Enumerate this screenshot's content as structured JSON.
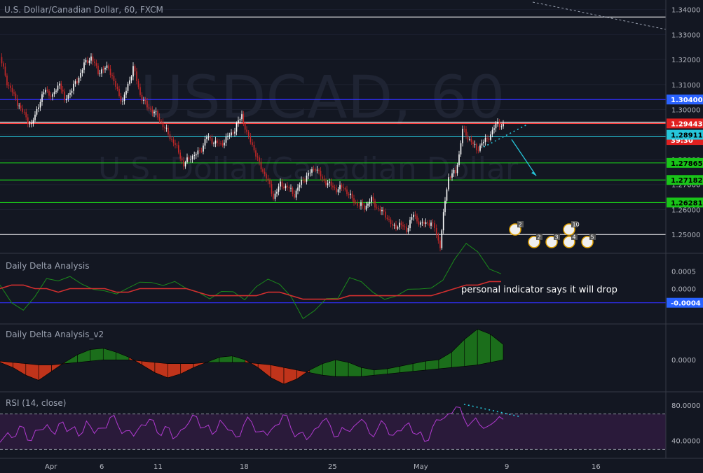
{
  "chart_data": [
    {
      "type": "candlestick",
      "title": "U.S. Dollar/Canadian Dollar, 60, FXCM",
      "watermark": {
        "symbol": "USDCAD, 60",
        "name": "U.S. Dollar/Canadian Dollar"
      },
      "x_ticks": [
        "Apr",
        "6",
        "11",
        "18",
        "25",
        "May",
        "9",
        "16"
      ],
      "y_ticks": [
        "1.34000",
        "1.33000",
        "1.32000",
        "1.31000",
        "1.30000",
        "1.29000",
        "1.28000",
        "1.27000",
        "1.26000",
        "1.25000"
      ],
      "ylim": [
        1.2425,
        1.3438
      ],
      "close_path": [
        [
          1.321,
          0
        ],
        [
          1.311,
          10
        ],
        [
          1.3055,
          20
        ],
        [
          1.299,
          32
        ],
        [
          1.2935,
          45
        ],
        [
          1.302,
          55
        ],
        [
          1.308,
          65
        ],
        [
          1.305,
          75
        ],
        [
          1.311,
          85
        ],
        [
          1.3035,
          92
        ],
        [
          1.307,
          100
        ],
        [
          1.3115,
          110
        ],
        [
          1.318,
          120
        ],
        [
          1.321,
          130
        ],
        [
          1.315,
          140
        ],
        [
          1.317,
          155
        ],
        [
          1.309,
          165
        ],
        [
          1.303,
          175
        ],
        [
          1.312,
          185
        ],
        [
          1.317,
          190
        ],
        [
          1.306,
          200
        ],
        [
          1.301,
          210
        ],
        [
          1.299,
          220
        ],
        [
          1.295,
          230
        ],
        [
          1.29,
          240
        ],
        [
          1.286,
          250
        ],
        [
          1.278,
          262
        ],
        [
          1.281,
          272
        ],
        [
          1.283,
          285
        ],
        [
          1.289,
          295
        ],
        [
          1.287,
          305
        ],
        [
          1.286,
          315
        ],
        [
          1.289,
          325
        ],
        [
          1.292,
          335
        ],
        [
          1.298,
          345
        ],
        [
          1.29,
          352
        ],
        [
          1.286,
          360
        ],
        [
          1.278,
          370
        ],
        [
          1.273,
          380
        ],
        [
          1.265,
          390
        ],
        [
          1.27,
          400
        ],
        [
          1.269,
          410
        ],
        [
          1.266,
          420
        ],
        [
          1.271,
          430
        ],
        [
          1.274,
          440
        ],
        [
          1.277,
          450
        ],
        [
          1.272,
          460
        ],
        [
          1.27,
          470
        ],
        [
          1.268,
          480
        ],
        [
          1.269,
          490
        ],
        [
          1.265,
          500
        ],
        [
          1.262,
          510
        ],
        [
          1.261,
          520
        ],
        [
          1.264,
          530
        ],
        [
          1.26,
          540
        ],
        [
          1.258,
          550
        ],
        [
          1.253,
          560
        ],
        [
          1.254,
          570
        ],
        [
          1.252,
          580
        ],
        [
          1.258,
          590
        ],
        [
          1.254,
          600
        ],
        [
          1.255,
          610
        ],
        [
          1.253,
          620
        ],
        [
          1.245,
          628
        ],
        [
          1.264,
          635
        ],
        [
          1.273,
          640
        ],
        [
          1.275,
          650
        ],
        [
          1.282,
          655
        ],
        [
          1.292,
          660
        ],
        [
          1.288,
          670
        ],
        [
          1.284,
          680
        ],
        [
          1.287,
          690
        ],
        [
          1.29,
          700
        ],
        [
          1.295,
          710
        ],
        [
          1.293,
          718
        ]
      ],
      "horizontal_levels": [
        {
          "value": 1.337,
          "color": "#ffffff",
          "label": ""
        },
        {
          "value": 1.304,
          "color": "#3030ff",
          "label": "1.30400"
        },
        {
          "value": 1.29493,
          "color": "#ffffff",
          "label": "1.29493"
        },
        {
          "value": 1.29443,
          "color": "#ff4040",
          "label": "1.29443"
        },
        {
          "value": 1.28911,
          "color": "#26c6da",
          "label": "1.28911"
        },
        {
          "value": 1.27865,
          "color": "#19c319",
          "label": "1.27865"
        },
        {
          "value": 1.27182,
          "color": "#19c319",
          "label": "1.27182"
        },
        {
          "value": 1.26281,
          "color": "#19c319",
          "label": "1.26281"
        },
        {
          "value": 1.25,
          "color": "#ffffff",
          "label": ""
        }
      ],
      "price_labels": [
        {
          "text": "1.30400",
          "value": 1.304,
          "bg": "#2962ff",
          "fg": "#ffffff"
        },
        {
          "text": "1.29493",
          "value": 1.29493,
          "bg": "#131722",
          "fg": "#ffffff"
        },
        {
          "text": "1.29443",
          "value": 1.29443,
          "bg": "#e02020",
          "fg": "#ffffff"
        },
        {
          "text": "39:30",
          "value": 1.28911,
          "bg": "#e02020",
          "fg": "#ffffff",
          "offset": -0.0013
        },
        {
          "text": "1.28911",
          "value": 1.28911,
          "bg": "#26c6da",
          "fg": "#000000",
          "offset": 0.0008
        },
        {
          "text": "1.27865",
          "value": 1.27865,
          "bg": "#19c319",
          "fg": "#000000"
        },
        {
          "text": "1.27182",
          "value": 1.27182,
          "bg": "#19c319",
          "fg": "#000000"
        },
        {
          "text": "1.26281",
          "value": 1.26281,
          "bg": "#19c319",
          "fg": "#000000"
        }
      ],
      "event_badges": [
        "2",
        "2",
        "3",
        "4",
        "5",
        "10"
      ],
      "colors": {
        "up": "#ffffff",
        "down": "#c62828",
        "accent": "#26c6da"
      }
    },
    {
      "type": "line",
      "title": "Daily Delta Analysis",
      "y_ticks": [
        "0.0005",
        "0.0000"
      ],
      "current_value_label": "-0.0004",
      "annotation": "personal indicator says it will drop",
      "series": [
        {
          "color": "#1b8a1b",
          "values": [
            0.0001,
            -0.0003,
            -0.0005,
            -0.0002,
            0.0002,
            0.0001,
            0.0003,
            0.0002,
            0.0001,
            0.0,
            -0.0002,
            -0.0001,
            0.0001,
            0.0002,
            0.0002,
            0.0003,
            0.0,
            -0.0002,
            -0.0004,
            -0.0001,
            0.0,
            -0.0002,
            0.0001,
            0.0002,
            0.0,
            -0.0003,
            -0.0008,
            -0.0005,
            -0.0002,
            -0.0003,
            0.0002,
            0.0001,
            -0.0001,
            -0.0002,
            -0.0001,
            0.0,
            -0.0001,
            -0.0001,
            0.0002,
            0.0009,
            0.0014,
            0.0011,
            0.0005,
            0.0003
          ]
        },
        {
          "color": "#d32f2f",
          "values": [
            0.0,
            0.0001,
            0.0001,
            0.0,
            0.0,
            -0.0001,
            0.0,
            0.0,
            0.0,
            0.0,
            -0.0001,
            -0.0001,
            0.0,
            0.0,
            0.0,
            0.0,
            0.0,
            -0.0001,
            -0.0002,
            -0.0002,
            -0.0002,
            -0.0002,
            -0.0002,
            -0.0001,
            -0.0001,
            -0.0002,
            -0.0003,
            -0.0003,
            -0.0003,
            -0.0003,
            -0.0002,
            -0.0002,
            -0.0002,
            -0.0002,
            -0.0002,
            -0.0002,
            -0.0002,
            -0.0002,
            -0.0001,
            0.0,
            0.0001,
            0.0001,
            0.0002,
            0.0002
          ]
        }
      ]
    },
    {
      "type": "area",
      "title": "Daily Delta Analysis_v2",
      "y_ticks": [
        "0.0000"
      ],
      "values": [
        -0.0002,
        -0.0006,
        -0.0012,
        -0.0016,
        -0.0009,
        -0.0002,
        0.0004,
        0.0008,
        0.0009,
        0.0006,
        0.0002,
        -0.0004,
        -0.001,
        -0.0014,
        -0.0011,
        -0.0006,
        -0.0002,
        0.0002,
        0.0003,
        0.0,
        -0.0006,
        -0.0014,
        -0.0019,
        -0.0015,
        -0.0008,
        -0.0003,
        0.0,
        -0.0002,
        -0.0006,
        -0.0008,
        -0.0007,
        -0.0005,
        -0.0003,
        -0.0001,
        0.0,
        0.0006,
        0.0016,
        0.0024,
        0.002,
        0.0012
      ],
      "baseline": [
        -0.0001,
        -0.0002,
        -0.0003,
        -0.0004,
        -0.0004,
        -0.0003,
        -0.0002,
        -0.0001,
        0.0,
        0.0,
        0.0,
        -0.0001,
        -0.0002,
        -0.0003,
        -0.0003,
        -0.0003,
        -0.0002,
        -0.0002,
        -0.0002,
        -0.0002,
        -0.0003,
        -0.0004,
        -0.0006,
        -0.0008,
        -0.001,
        -0.0012,
        -0.0013,
        -0.0013,
        -0.0013,
        -0.0012,
        -0.0011,
        -0.001,
        -0.0009,
        -0.0008,
        -0.0007,
        -0.0006,
        -0.0005,
        -0.0004,
        -0.0002,
        0.0
      ],
      "colors": {
        "positive": "#1b6e1b",
        "negative": "#c0341b"
      }
    },
    {
      "type": "line",
      "title": "RSI (14, close)",
      "y_ticks": [
        "80.0000",
        "40.0000"
      ],
      "bands": [
        70,
        30
      ],
      "values": [
        38,
        49,
        45,
        55,
        40,
        52,
        58,
        47,
        61,
        53,
        45,
        62,
        48,
        54,
        66,
        57,
        51,
        45,
        58,
        64,
        49,
        56,
        42,
        52,
        60,
        67,
        55,
        47,
        63,
        52,
        44,
        58,
        61,
        50,
        46,
        57,
        69,
        54,
        48,
        41,
        53,
        62,
        57,
        45,
        52,
        56,
        64,
        48,
        53,
        58,
        46,
        51,
        60,
        47,
        39,
        55,
        63,
        70,
        78,
        65,
        61,
        58,
        56,
        62,
        64
      ],
      "color": "#b03ad0"
    }
  ]
}
